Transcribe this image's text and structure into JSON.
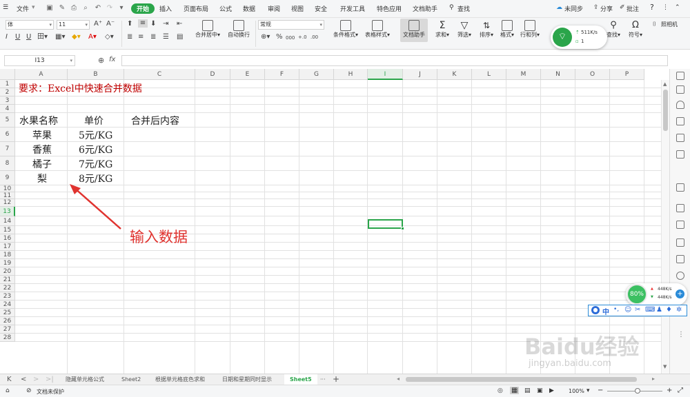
{
  "menubar": {
    "file_label": "文件",
    "tabs": [
      "开始",
      "插入",
      "页面布局",
      "公式",
      "数据",
      "审阅",
      "视图",
      "安全",
      "开发工具",
      "特色应用",
      "文档助手"
    ],
    "active_tab": "开始",
    "search_label": "查找",
    "sync_label": "未同步",
    "share_label": "分享",
    "annotate_label": "批注",
    "help_label": "?"
  },
  "ribbon": {
    "font_name": "体",
    "font_size": "11",
    "number_format": "常规",
    "merge_label": "合并居中",
    "wrap_label": "自动换行",
    "cond_format_label": "条件格式",
    "table_style_label": "表格样式",
    "doc_helper_label": "文档助手",
    "sum_label": "求和",
    "filter_label": "筛选",
    "sort_label": "排序",
    "format_label": "格式",
    "rowcol_label": "行和列",
    "find_label": "查找",
    "symbol_label": "符号",
    "camera_label": "照相机",
    "percent_symbol": "%",
    "thousands_symbol": "000"
  },
  "network_widget": {
    "speed": "511K/s",
    "count": "1"
  },
  "formula_bar": {
    "cell_ref": "I13",
    "fx_label": "fx",
    "content": ""
  },
  "columns": [
    "A",
    "B",
    "C",
    "D",
    "E",
    "F",
    "G",
    "H",
    "I",
    "J",
    "K",
    "L",
    "M",
    "N",
    "O",
    "P"
  ],
  "rows": [
    "1",
    "2",
    "3",
    "4",
    "5",
    "6",
    "7",
    "8",
    "9",
    "10",
    "11",
    "12",
    "13",
    "14",
    "15",
    "16",
    "17",
    "18",
    "19",
    "20",
    "21",
    "22",
    "23",
    "24",
    "25",
    "26",
    "27",
    "28"
  ],
  "cells": {
    "a1": "要求：Excel中快速合并数据",
    "a4": "水果名称",
    "b4": "单价",
    "c4": "合并后内容",
    "a5": "苹果",
    "b5": "5元/KG",
    "a6": "香蕉",
    "b6": "6元/KG",
    "a7": "橘子",
    "b7": "7元/KG",
    "a8": "梨",
    "b8": "8元/KG"
  },
  "annotation": {
    "text": "输入数据",
    "color": "#e0332f"
  },
  "speed_widget": {
    "percent": "80%",
    "up": "448K/s",
    "down": "448K/s"
  },
  "ime_bar": {
    "mode": "中"
  },
  "watermark": {
    "line1": "Baidu经验",
    "line2": "jingyan.baidu.com"
  },
  "sheets": [
    "隐藏单元格公式",
    "Sheet2",
    "根据单元格底色求和",
    "日期和星期同时显示",
    "Sheet5"
  ],
  "active_sheet": "Sheet5",
  "status": {
    "protect_label": "文档未保护",
    "zoom": "100%"
  },
  "colors": {
    "accent": "#2aa54a",
    "title_red": "#c00000",
    "selection": "#2aa54a"
  }
}
